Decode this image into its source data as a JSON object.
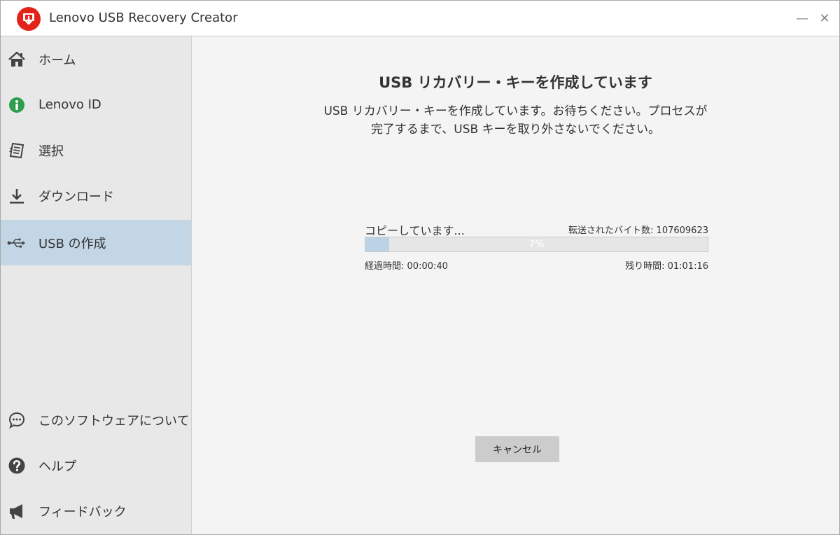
{
  "window": {
    "title": "Lenovo USB Recovery Creator",
    "minimize_glyph": "—",
    "close_glyph": "✕",
    "accent_color": "#e2231a"
  },
  "sidebar": {
    "items": [
      {
        "label": "ホーム",
        "icon": "home-icon"
      },
      {
        "label": "Lenovo ID",
        "icon": "lenovo-id-icon"
      },
      {
        "label": "選択",
        "icon": "select-document-icon"
      },
      {
        "label": "ダウンロード",
        "icon": "download-icon"
      },
      {
        "label": "USB の作成",
        "icon": "usb-icon",
        "active": true
      },
      {
        "label": "このソフトウェアについて",
        "icon": "chat-bubble-icon"
      },
      {
        "label": "ヘルプ",
        "icon": "help-icon"
      },
      {
        "label": "フィードバック",
        "icon": "megaphone-icon"
      }
    ],
    "active_color": "#c3d6e6"
  },
  "main": {
    "heading": "USB リカバリー・キーを作成しています",
    "description": "USB リカバリー・キーを作成しています。お待ちください。プロセスが完了するまで、USB キーを取り外さないでください。",
    "status": "コピーしています...",
    "bytes_label": "転送されたバイト数:",
    "bytes_value": "107609623",
    "progress_percent": 7,
    "progress_text": "7%",
    "elapsed_label": "経過時間:",
    "elapsed_value": "00:00:40",
    "remaining_label": "残り時間:",
    "remaining_value": "01:01:16",
    "cancel_label": "キャンセル"
  }
}
